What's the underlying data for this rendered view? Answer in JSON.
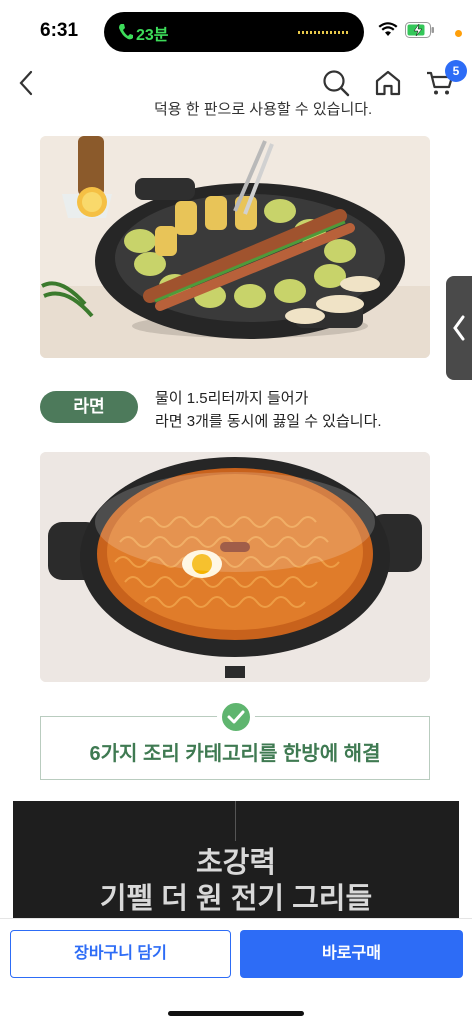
{
  "status_bar": {
    "time": "6:31",
    "call_timer": "23분",
    "icons": [
      "call-icon",
      "wifi-icon",
      "battery-charging-icon"
    ]
  },
  "nav": {
    "cart_count": "5",
    "icons": [
      "back-icon",
      "search-icon",
      "home-icon",
      "cart-icon"
    ]
  },
  "content": {
    "top_caption": "덕용 한 판으로 사용할 수 있습니다.",
    "ramen_badge": "라면",
    "ramen_desc_line1": "물이 1.5리터까지 들어가",
    "ramen_desc_line2": "라면 3개를 동시에 끓일 수 있습니다.",
    "check_title": "6가지 조리 카테고리를 한방에 해결",
    "banner_line1": "초강력",
    "banner_line2": "기펠 더 원 전기 그리들"
  },
  "bottom": {
    "add_to_cart": "장바구니 담기",
    "buy_now": "바로구매"
  },
  "colors": {
    "accent_blue": "#2d6cf6",
    "badge_green": "#4d7a5b",
    "check_green": "#5fb56f",
    "title_green": "#3f7a52"
  }
}
